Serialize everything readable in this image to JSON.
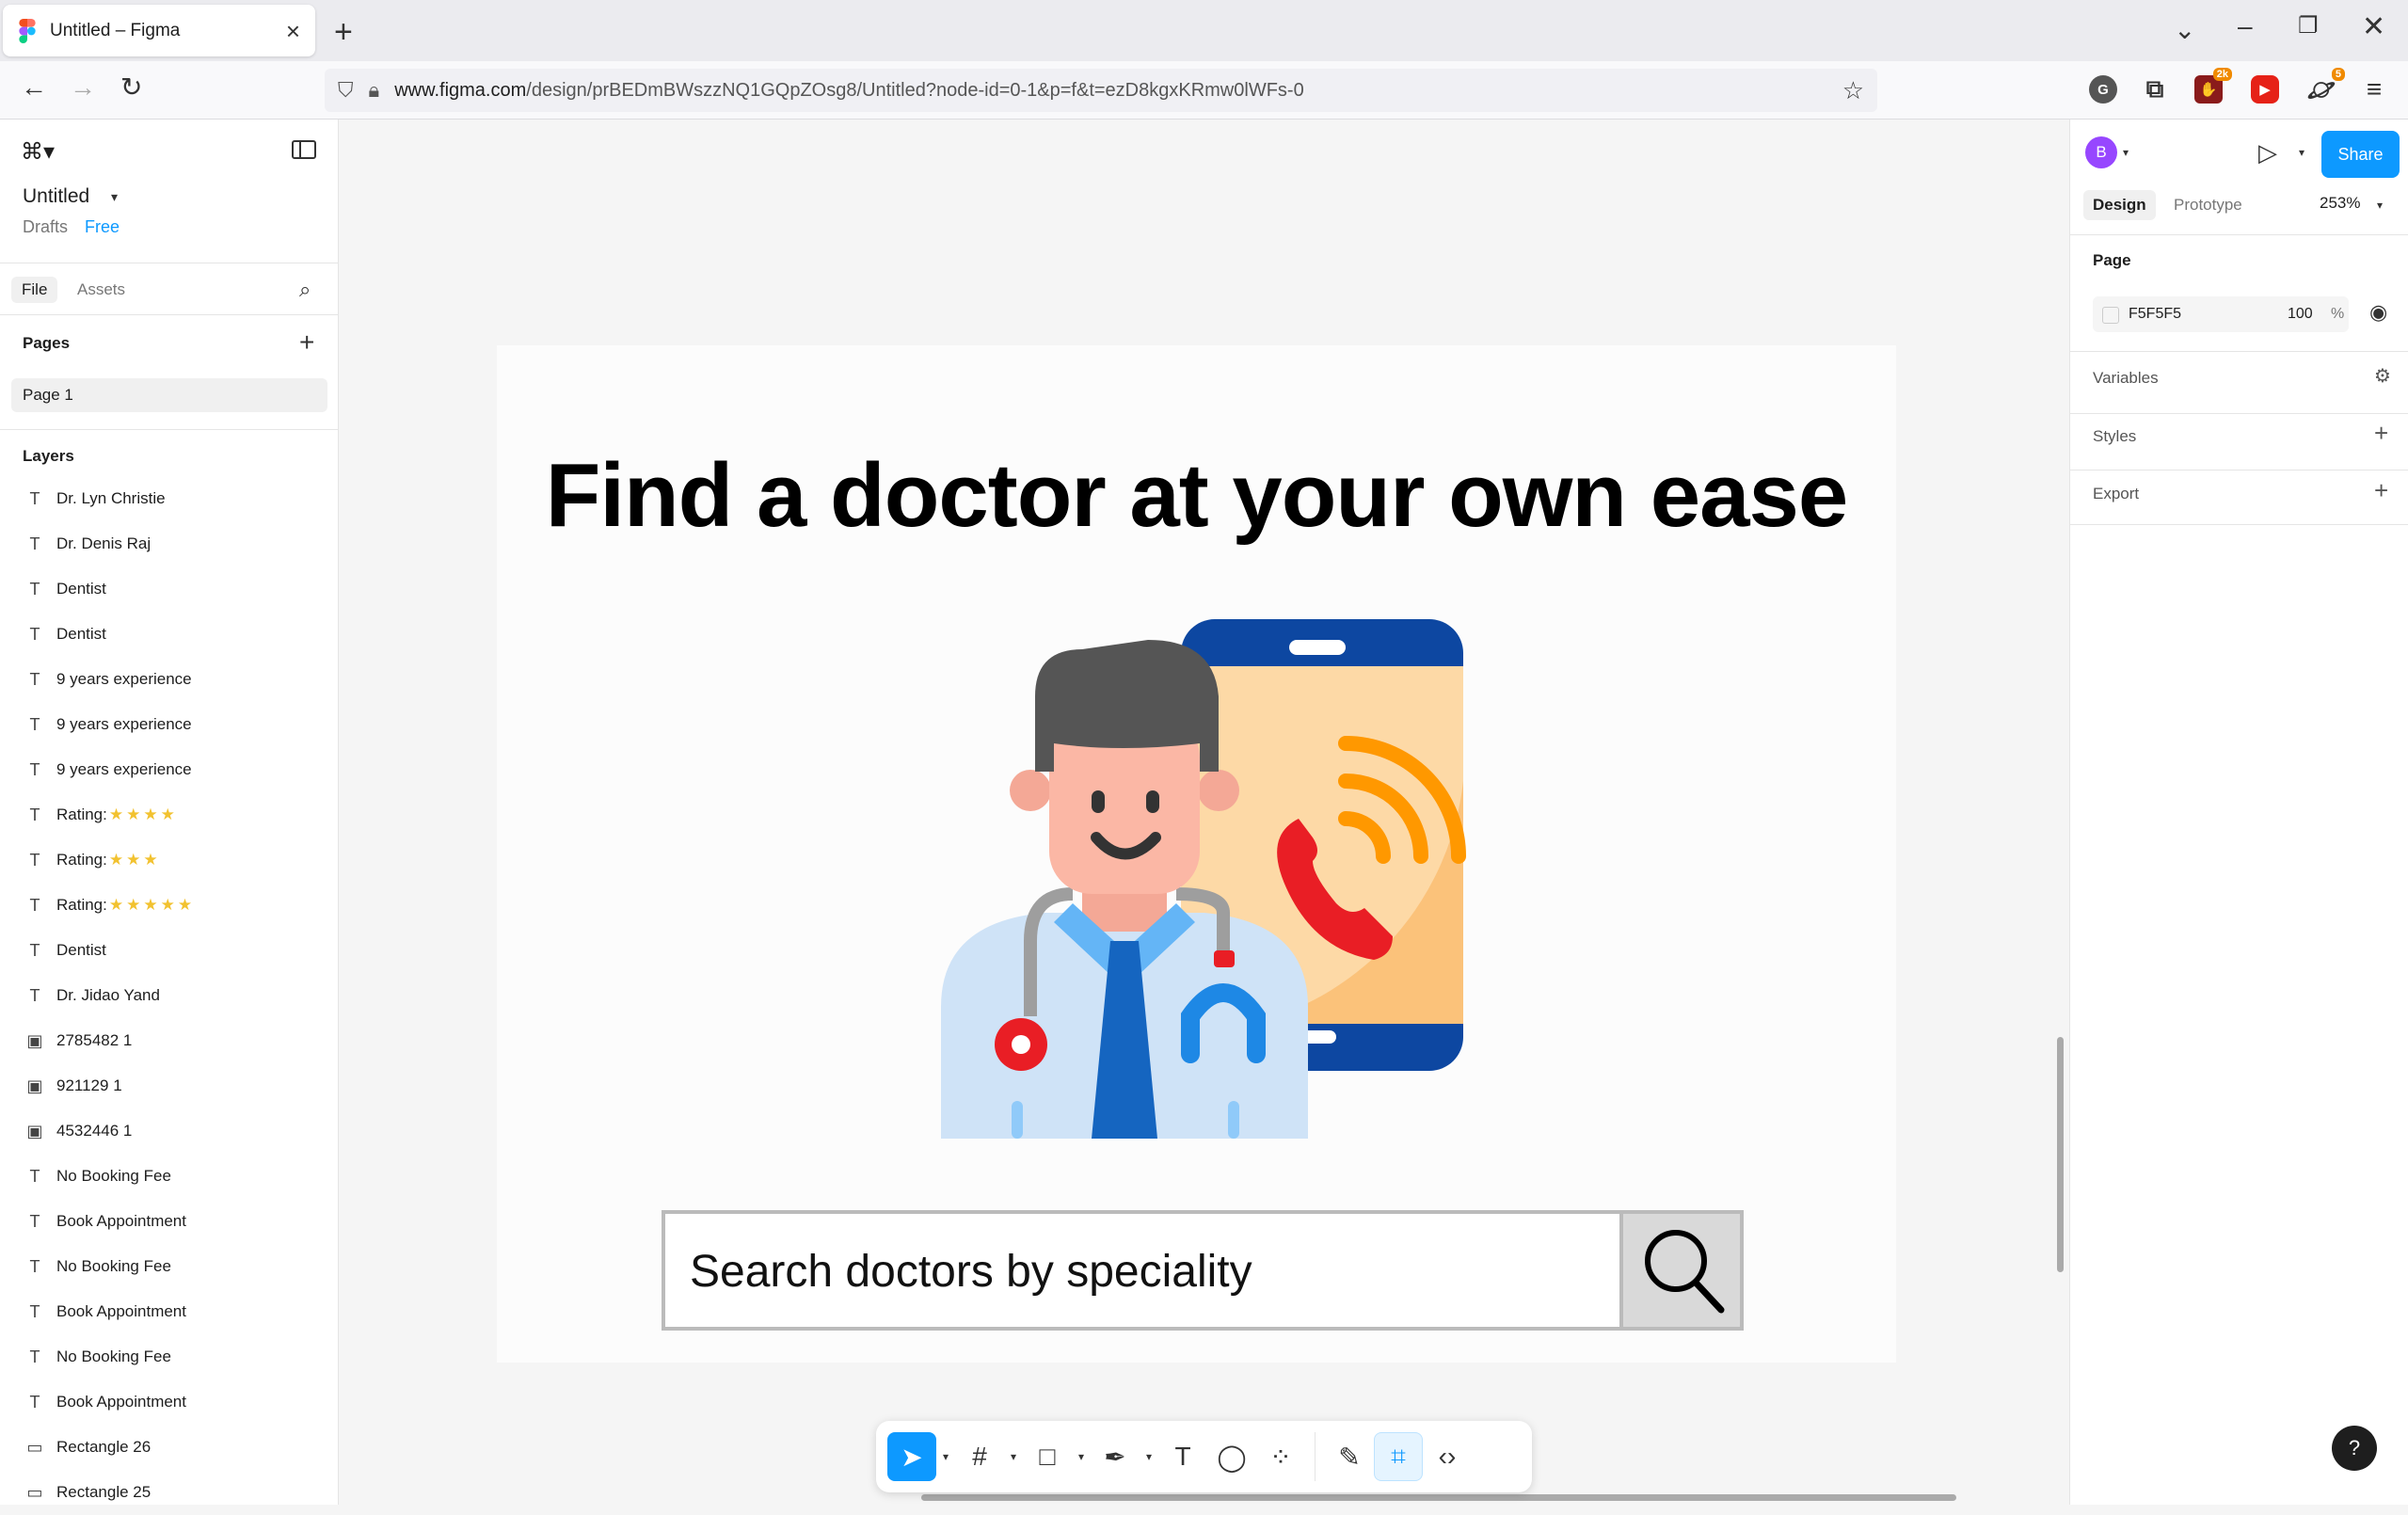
{
  "browser": {
    "tab_title": "Untitled – Figma",
    "url_domain": "www.figma.com",
    "url_path": "/design/prBEDmBWszzNQ1GQpZOsg8/Untitled?node-id=0-1&p=f&t=ezD8kgxKRmw0lWFs-0",
    "ext_badge_a": "2k",
    "ext_badge_s": "5"
  },
  "left_panel": {
    "file_name": "Untitled",
    "location": "Drafts",
    "plan": "Free",
    "tab_file": "File",
    "tab_assets": "Assets",
    "pages_heading": "Pages",
    "current_page": "Page 1",
    "layers_heading": "Layers",
    "layers": [
      {
        "icon": "text-icon",
        "label": "Dr. Lyn Christie",
        "stars": ""
      },
      {
        "icon": "text-icon",
        "label": "Dr. Denis Raj",
        "stars": ""
      },
      {
        "icon": "text-icon",
        "label": "Dentist",
        "stars": ""
      },
      {
        "icon": "text-icon",
        "label": "Dentist",
        "stars": ""
      },
      {
        "icon": "text-icon",
        "label": "9 years experience",
        "stars": ""
      },
      {
        "icon": "text-icon",
        "label": "9 years experience",
        "stars": ""
      },
      {
        "icon": "text-icon",
        "label": "9 years experience",
        "stars": ""
      },
      {
        "icon": "text-icon",
        "label": "Rating:",
        "stars": "★★★★"
      },
      {
        "icon": "text-icon",
        "label": "Rating:",
        "stars": "★★★"
      },
      {
        "icon": "text-icon",
        "label": "Rating:",
        "stars": "★★★★★"
      },
      {
        "icon": "text-icon",
        "label": "Dentist",
        "stars": ""
      },
      {
        "icon": "text-icon",
        "label": "Dr. Jidao Yand",
        "stars": ""
      },
      {
        "icon": "image-icon",
        "label": "2785482 1",
        "stars": ""
      },
      {
        "icon": "image-icon",
        "label": "921129 1",
        "stars": ""
      },
      {
        "icon": "image-icon",
        "label": "4532446 1",
        "stars": ""
      },
      {
        "icon": "text-icon",
        "label": "No Booking Fee",
        "stars": ""
      },
      {
        "icon": "text-icon",
        "label": "Book Appointment",
        "stars": ""
      },
      {
        "icon": "text-icon",
        "label": "No Booking Fee",
        "stars": ""
      },
      {
        "icon": "text-icon",
        "label": "Book Appointment",
        "stars": ""
      },
      {
        "icon": "text-icon",
        "label": "No Booking Fee",
        "stars": ""
      },
      {
        "icon": "text-icon",
        "label": "Book Appointment",
        "stars": ""
      },
      {
        "icon": "rectangle-icon",
        "label": "Rectangle 26",
        "stars": ""
      },
      {
        "icon": "rectangle-icon",
        "label": "Rectangle 25",
        "stars": ""
      }
    ]
  },
  "canvas": {
    "headline": "Find a doctor at your own ease",
    "search_placeholder": "Search doctors by speciality"
  },
  "right_panel": {
    "avatar_initial": "B",
    "share_label": "Share",
    "tab_design": "Design",
    "tab_prototype": "Prototype",
    "zoom": "253%",
    "page_heading": "Page",
    "page_fill_hex": "F5F5F5",
    "page_fill_opacity": "100",
    "page_fill_unit": "%",
    "variables_label": "Variables",
    "styles_label": "Styles",
    "export_label": "Export",
    "help_label": "?"
  },
  "colors": {
    "accent": "#0d99ff",
    "avatar": "#9747ff",
    "page_fill": "#F5F5F5"
  }
}
